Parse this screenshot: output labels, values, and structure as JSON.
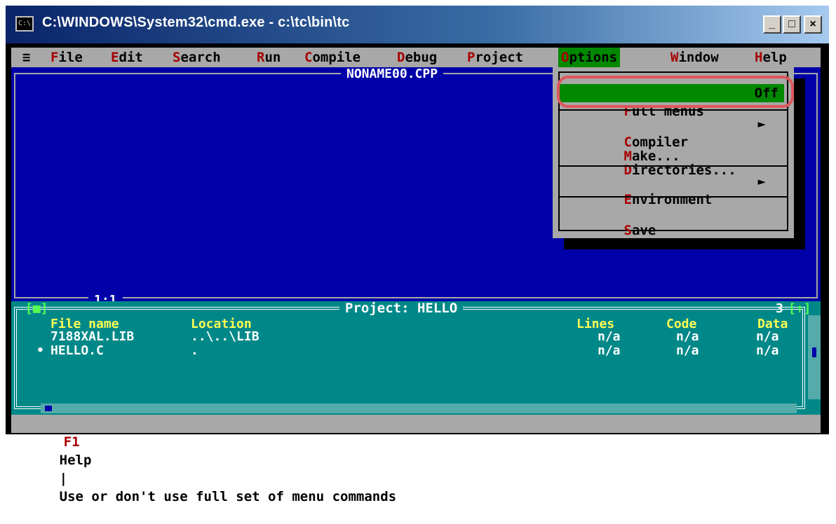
{
  "window": {
    "title": "C:\\WINDOWS\\System32\\cmd.exe - c:\\tc\\bin\\tc",
    "icon_name": "console-icon",
    "buttons": {
      "minimize": "_",
      "maximize": "□",
      "close": "×"
    }
  },
  "menubar": {
    "items": [
      {
        "label": "≡",
        "hot": ""
      },
      {
        "label": "File",
        "hot": "F"
      },
      {
        "label": "Edit",
        "hot": "E"
      },
      {
        "label": "Search",
        "hot": "S"
      },
      {
        "label": "Run",
        "hot": "R"
      },
      {
        "label": "Compile",
        "hot": "C"
      },
      {
        "label": "Debug",
        "hot": "D"
      },
      {
        "label": "Project",
        "hot": "P"
      },
      {
        "label": "Options",
        "hot": "O"
      },
      {
        "label": "Window",
        "hot": "W"
      },
      {
        "label": "Help",
        "hot": "H"
      }
    ],
    "active": "Options"
  },
  "editor": {
    "filename": "NONAME00.CPP",
    "cursor_position": "1:1"
  },
  "options_menu": {
    "full_menus": {
      "label": "Full menus",
      "hot": "F",
      "value": "Off"
    },
    "compiler": {
      "label": "Compiler",
      "hot": "C"
    },
    "make": {
      "label": "Make...",
      "hot": "M"
    },
    "directories": {
      "label": "Directories...",
      "hot": "D"
    },
    "environment": {
      "label": "Environment",
      "hot": "E"
    },
    "save": {
      "label": "Save",
      "hot": "S"
    },
    "submenu_arrow": "►"
  },
  "project": {
    "title": "Project: HELLO",
    "window_number": "3",
    "columns": [
      "File name",
      "Location",
      "Lines",
      "Code",
      "Data"
    ],
    "rows": [
      {
        "marker": "",
        "file": "7188XAL.LIB",
        "location": "..\\..\\LIB",
        "lines": "n/a",
        "code": "n/a",
        "data": "n/a"
      },
      {
        "marker": "•",
        "file": "HELLO.C",
        "location": ".",
        "lines": "n/a",
        "code": "n/a",
        "data": "n/a"
      }
    ]
  },
  "status": {
    "key": "F1",
    "key_label": "Help",
    "separator": "|",
    "message": "Use or don't use full set of menu commands"
  },
  "colors": {
    "desktop_blue": "#0000a8",
    "menu_gray": "#a8a8a8",
    "selection_green": "#008800",
    "project_teal": "#008888",
    "hotkey_red": "#a80000",
    "highlight_ring": "#e0565b"
  }
}
